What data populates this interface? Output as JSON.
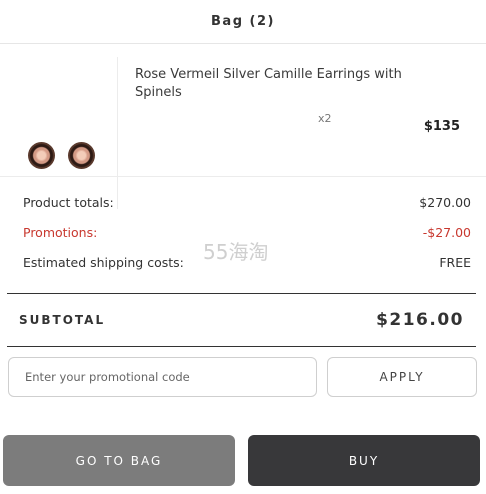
{
  "header": {
    "title": "Bag (2)"
  },
  "product": {
    "name": "Rose Vermeil Silver Camille Earrings with Spinels",
    "quantity": "x2",
    "price": "$135"
  },
  "totals": {
    "product_totals_label": "Product totals:",
    "product_totals_value": "$270.00",
    "promotions_label": "Promotions:",
    "promotions_value": "-$27.00",
    "shipping_label": "Estimated shipping costs:",
    "shipping_value": "FREE"
  },
  "watermark": "55海淘",
  "subtotal": {
    "label": "SUBTOTAL",
    "value": "$216.00"
  },
  "promo": {
    "placeholder": "Enter your promotional code",
    "apply_label": "APPLY"
  },
  "actions": {
    "go_to_bag_label": "GO TO BAG",
    "buy_label": "BUY"
  },
  "colors": {
    "promotion_red": "#c8382f",
    "go_to_bag_bg": "#7c7c7c",
    "buy_bg": "#38383a"
  },
  "icons": {
    "product_thumbnail": "earrings-image"
  }
}
